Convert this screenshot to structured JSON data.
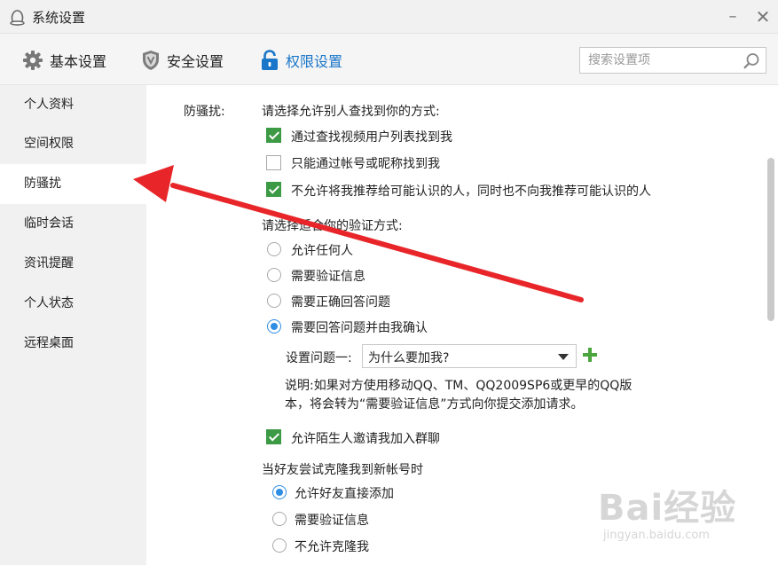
{
  "window": {
    "title": "系统设置",
    "minimize": "–",
    "close": "✕"
  },
  "toolbar": {
    "tabs": [
      {
        "label": "基本设置",
        "icon": "gear-icon"
      },
      {
        "label": "安全设置",
        "icon": "shield-icon"
      },
      {
        "label": "权限设置",
        "icon": "lock-icon",
        "active": true
      }
    ],
    "search_placeholder": "搜索设置项"
  },
  "sidebar": {
    "items": [
      {
        "label": "个人资料"
      },
      {
        "label": "空间权限"
      },
      {
        "label": "防骚扰",
        "active": true
      },
      {
        "label": "临时会话"
      },
      {
        "label": "资讯提醒"
      },
      {
        "label": "个人状态"
      },
      {
        "label": "远程桌面"
      }
    ]
  },
  "content": {
    "section_label": "防骚扰:",
    "find_prompt": "请选择允许别人查找到你的方式:",
    "find_options": [
      {
        "label": "通过查找视频用户列表找到我",
        "checked": true
      },
      {
        "label": "只能通过帐号或昵称找到我",
        "checked": false
      },
      {
        "label": "不允许将我推荐给可能认识的人，同时也不向我推荐可能认识的人",
        "checked": true
      }
    ],
    "verify_prompt": "请选择适合你的验证方式:",
    "verify_options": [
      {
        "label": "允许任何人",
        "selected": false
      },
      {
        "label": "需要验证信息",
        "selected": false
      },
      {
        "label": "需要正确回答问题",
        "selected": false
      },
      {
        "label": "需要回答问题并由我确认",
        "selected": true
      }
    ],
    "question_label": "设置问题一:",
    "question_value": "为什么要加我?",
    "note_line1": "说明:如果对方使用移动QQ、TM、QQ2009SP6或更早的QQ版",
    "note_line2": "本，将会转为“需要验证信息”方式向你提交添加请求。",
    "group_invite": {
      "label": "允许陌生人邀请我加入群聊",
      "checked": true
    },
    "clone_prompt": "当好友尝试克隆我到新帐号时",
    "clone_options": [
      {
        "label": "允许好友直接添加",
        "selected": true
      },
      {
        "label": "需要验证信息",
        "selected": false
      },
      {
        "label": "不允许克隆我",
        "selected": false
      }
    ]
  },
  "watermark": {
    "logo": "Bai经验",
    "url": "jingyan.baidu.com"
  },
  "colors": {
    "accent": "#1a76c8",
    "check": "#3c9a45",
    "radio": "#2f8de4",
    "annotation_arrow": "#e8262a"
  }
}
